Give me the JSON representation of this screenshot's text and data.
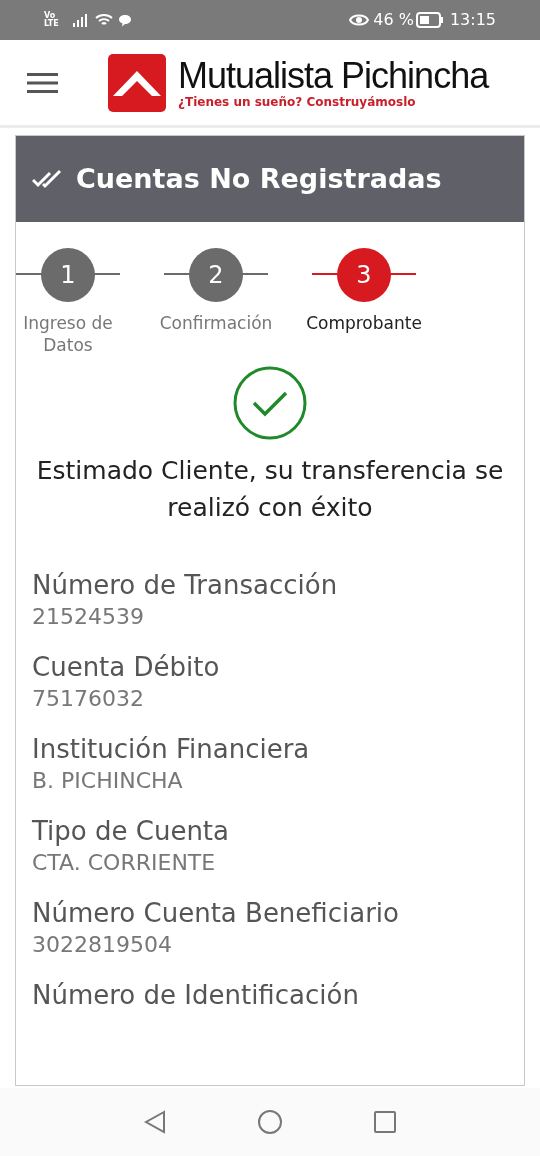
{
  "status_bar": {
    "network": "Vo LTE",
    "battery": "46 %",
    "time": "13:15"
  },
  "header": {
    "brand": "Mutualista Pichincha",
    "tagline": "¿Tienes un sueño? Construyámoslo"
  },
  "card": {
    "title": "Cuentas No Registradas",
    "steps": [
      {
        "number": "1",
        "label": "Ingreso de Datos",
        "active": false
      },
      {
        "number": "2",
        "label": "Confirmación",
        "active": false
      },
      {
        "number": "3",
        "label": "Comprobante",
        "active": true
      }
    ],
    "message": "Estimado Cliente, su transferencia se realizó con éxito",
    "fields": [
      {
        "label": "Número de Transacción",
        "value": "21524539"
      },
      {
        "label": "Cuenta Débito",
        "value": "75176032"
      },
      {
        "label": "Institución Financiera",
        "value": "B. PICHINCHA"
      },
      {
        "label": "Tipo de Cuenta",
        "value": "CTA. CORRIENTE"
      },
      {
        "label": "Número Cuenta Beneficiario",
        "value": "3022819504"
      },
      {
        "label": "Número de Identificación"
      }
    ]
  }
}
